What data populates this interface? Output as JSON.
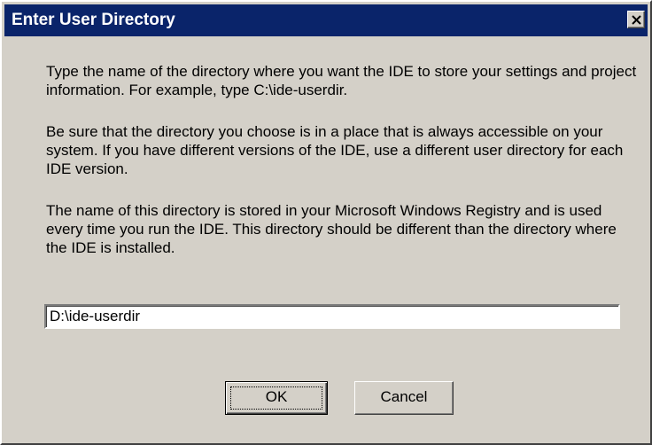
{
  "dialog": {
    "title": "Enter User Directory",
    "close_icon": "close-x-icon"
  },
  "message": {
    "paragraph1": "Type the name of the directory where you want the IDE to store your settings and project information.  For example, type C:\\ide-userdir.",
    "paragraph2": "Be sure that the directory you choose is in a place that is always accessible on your system. If you have different versions of the IDE, use a different user directory for each IDE version.",
    "paragraph3": "The name of this directory is stored in your Microsoft Windows Registry and is used every time you run the IDE. This directory should be different than the directory where the IDE is installed."
  },
  "directory_input": {
    "value": "D:\\ide-userdir"
  },
  "buttons": {
    "ok_label": "OK",
    "cancel_label": "Cancel"
  },
  "colors": {
    "titlebar": "#0a246a",
    "face": "#d4d0c8"
  }
}
